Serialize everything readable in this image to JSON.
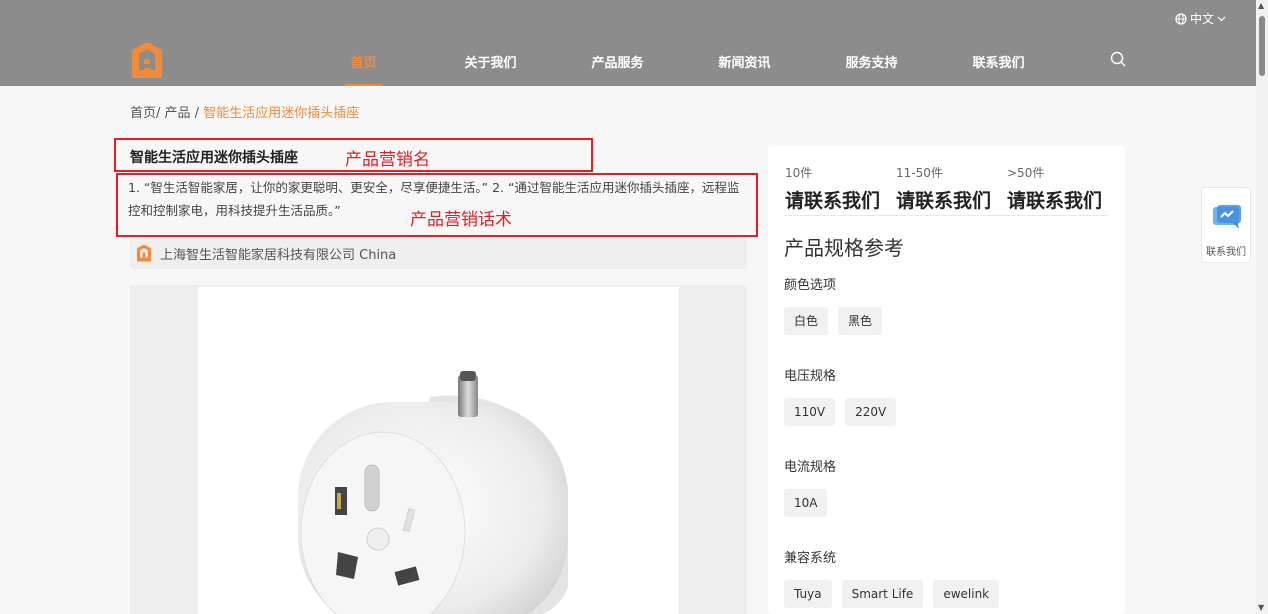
{
  "header": {
    "language": "中文",
    "nav": [
      "首页",
      "关于我们",
      "产品服务",
      "新闻资讯",
      "服务支持",
      "联系我们"
    ],
    "active_index": 0
  },
  "breadcrumb": {
    "home": "首页",
    "sep1": "/ ",
    "category": "产品",
    "sep2": " / ",
    "current": "智能生活应用迷你插头插座"
  },
  "product": {
    "title": "智能生活应用迷你插头插座",
    "title_annotation": "产品营销名",
    "description": "1. “智生活智能家居，让你的家更聪明、更安全，尽享便捷生活。” 2. “通过智能生活应用迷你插头插座，远程监控和控制家电，用科技提升生活品质。”",
    "description_annotation": "产品营销话术",
    "company": "上海智生活智能家居科技有限公司 China"
  },
  "pricing": {
    "tiers": [
      {
        "range": "10件",
        "price": "请联系我们"
      },
      {
        "range": "11-50件",
        "price": "请联系我们"
      },
      {
        "range": ">50件",
        "price": "请联系我们"
      }
    ]
  },
  "specs": {
    "title": "产品规格参考",
    "groups": [
      {
        "label": "颜色选项",
        "options": [
          "白色",
          "黑色"
        ]
      },
      {
        "label": "电压规格",
        "options": [
          "110V",
          "220V"
        ]
      },
      {
        "label": "电流规格",
        "options": [
          "10A"
        ]
      },
      {
        "label": "兼容系统",
        "options": [
          "Tuya",
          "Smart Life",
          "ewelink"
        ]
      }
    ]
  },
  "float_contact": {
    "label": "联系我们"
  },
  "colors": {
    "accent": "#f08a3c",
    "header_bg": "#8c8c8c",
    "annotation_red": "#e31e24"
  }
}
